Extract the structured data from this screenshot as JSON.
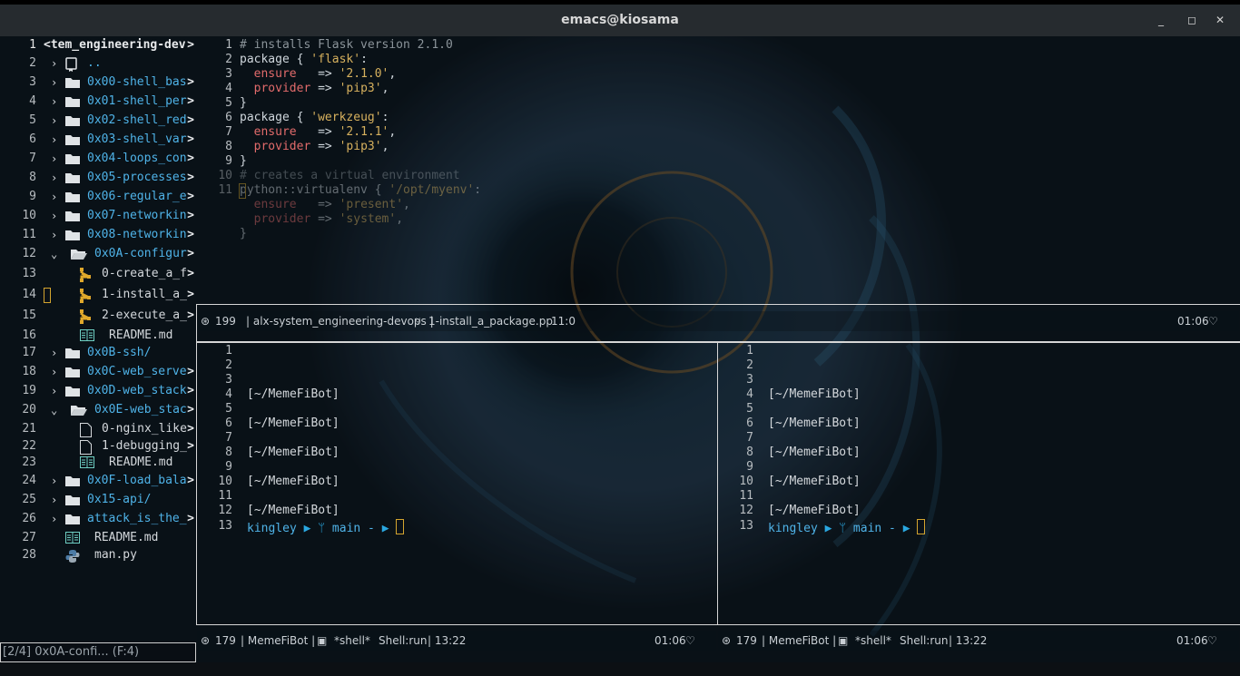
{
  "window": {
    "title": "emacs@kiosama",
    "minimize": "_",
    "maximize": "◻",
    "close": "✕"
  },
  "sidebar": {
    "rows": [
      {
        "ln": "1",
        "name": "<tem_engineering-dev",
        "kind": "root",
        "trunc": ">"
      },
      {
        "ln": "2",
        "name": "..",
        "kind": "up",
        "trunc": ""
      },
      {
        "ln": "3",
        "name": "0x00-shell_bas",
        "kind": "dir",
        "trunc": ">"
      },
      {
        "ln": "4",
        "name": "0x01-shell_per",
        "kind": "dir",
        "trunc": ">"
      },
      {
        "ln": "5",
        "name": "0x02-shell_red",
        "kind": "dir",
        "trunc": ">"
      },
      {
        "ln": "6",
        "name": "0x03-shell_var",
        "kind": "dir",
        "trunc": ">"
      },
      {
        "ln": "7",
        "name": "0x04-loops_con",
        "kind": "dir",
        "trunc": ">"
      },
      {
        "ln": "8",
        "name": "0x05-processes",
        "kind": "dir",
        "trunc": ">"
      },
      {
        "ln": "9",
        "name": "0x06-regular_e",
        "kind": "dir",
        "trunc": ">"
      },
      {
        "ln": "10",
        "name": "0x07-networkin",
        "kind": "dir",
        "trunc": ">"
      },
      {
        "ln": "11",
        "name": "0x08-networkin",
        "kind": "dir",
        "trunc": ">"
      },
      {
        "ln": "12",
        "name": "0x0A-configur",
        "kind": "diropen",
        "trunc": ">"
      },
      {
        "ln": "13",
        "name": "0-create_a_f",
        "kind": "pp",
        "trunc": ">"
      },
      {
        "ln": "14",
        "name": "1-install_a_",
        "kind": "pp",
        "trunc": ">"
      },
      {
        "ln": "15",
        "name": "2-execute_a_",
        "kind": "pp",
        "trunc": ">"
      },
      {
        "ln": "16",
        "name": "README.md",
        "kind": "md",
        "trunc": ""
      },
      {
        "ln": "17",
        "name": "0x0B-ssh/",
        "kind": "dir",
        "trunc": ""
      },
      {
        "ln": "18",
        "name": "0x0C-web_serve",
        "kind": "dir",
        "trunc": ">"
      },
      {
        "ln": "19",
        "name": "0x0D-web_stack",
        "kind": "dir",
        "trunc": ">"
      },
      {
        "ln": "20",
        "name": "0x0E-web_stac",
        "kind": "diropen",
        "trunc": ">"
      },
      {
        "ln": "21",
        "name": "0-nginx_like",
        "kind": "file",
        "trunc": ">"
      },
      {
        "ln": "22",
        "name": "1-debugging_",
        "kind": "file",
        "trunc": ">"
      },
      {
        "ln": "23",
        "name": "README.md",
        "kind": "md",
        "trunc": ""
      },
      {
        "ln": "24",
        "name": "0x0F-load_bala",
        "kind": "dir",
        "trunc": ">"
      },
      {
        "ln": "25",
        "name": "0x15-api/",
        "kind": "dir",
        "trunc": ""
      },
      {
        "ln": "26",
        "name": "attack_is_the_",
        "kind": "dir",
        "trunc": ">"
      },
      {
        "ln": "27",
        "name": "README.md",
        "kind": "md0",
        "trunc": ""
      },
      {
        "ln": "28",
        "name": "man.py",
        "kind": "py",
        "trunc": ""
      }
    ]
  },
  "editor": {
    "lines": [
      {
        "ln": "1",
        "text": "# installs Flask version 2.1.0"
      },
      {
        "ln": "2",
        "text": "package { 'flask':"
      },
      {
        "ln": "3",
        "text": "  ensure   => '2.1.0',"
      },
      {
        "ln": "4",
        "text": "  provider => 'pip3',"
      },
      {
        "ln": "5",
        "text": "}"
      },
      {
        "ln": "6",
        "text": "package { 'werkzeug':"
      },
      {
        "ln": "7",
        "text": "  ensure   => '2.1.1',"
      },
      {
        "ln": "8",
        "text": "  provider => 'pip3',"
      },
      {
        "ln": "9",
        "text": "}"
      },
      {
        "ln": "10",
        "text": "# creates a virtual environment"
      },
      {
        "ln": "11",
        "text": "python::virtualenv { '/opt/myenv':"
      },
      {
        "ln": "",
        "text": "  ensure   => 'present',"
      },
      {
        "ln": "",
        "text": "  provider => 'system',"
      },
      {
        "ln": "",
        "text": "}"
      }
    ],
    "modeline": {
      "icon": "⊛",
      "size": "199",
      "project": "| alx-system_engineering-devops |",
      "file": "1-install_a_package.pp",
      "pos": "11:0",
      "time": "01:06"
    }
  },
  "shells": [
    {
      "lines": [
        {
          "ln": "1",
          "text": ""
        },
        {
          "ln": "2",
          "text": ""
        },
        {
          "ln": "3",
          "text": ""
        },
        {
          "ln": "4",
          "text": "[~/MemeFiBot]"
        },
        {
          "ln": "5",
          "text": ""
        },
        {
          "ln": "6",
          "text": "[~/MemeFiBot]"
        },
        {
          "ln": "7",
          "text": ""
        },
        {
          "ln": "8",
          "text": "[~/MemeFiBot]"
        },
        {
          "ln": "9",
          "text": ""
        },
        {
          "ln": "10",
          "text": "[~/MemeFiBot]"
        },
        {
          "ln": "11",
          "text": ""
        },
        {
          "ln": "12",
          "text": "[~/MemeFiBot]"
        }
      ],
      "prompt": {
        "ln": "13",
        "user": "kingley",
        "branch": "main -"
      },
      "modeline": {
        "icon": "⊛",
        "size": "179",
        "buffer": "| MemeFiBot |",
        "shell": "*shell*",
        "mode": "Shell:run",
        "pos": "| 13:22",
        "time": "01:06"
      }
    },
    {
      "lines": [
        {
          "ln": "1",
          "text": ""
        },
        {
          "ln": "2",
          "text": ""
        },
        {
          "ln": "3",
          "text": ""
        },
        {
          "ln": "4",
          "text": "[~/MemeFiBot]"
        },
        {
          "ln": "5",
          "text": ""
        },
        {
          "ln": "6",
          "text": "[~/MemeFiBot]"
        },
        {
          "ln": "7",
          "text": ""
        },
        {
          "ln": "8",
          "text": "[~/MemeFiBot]"
        },
        {
          "ln": "9",
          "text": ""
        },
        {
          "ln": "10",
          "text": "[~/MemeFiBot]"
        },
        {
          "ln": "11",
          "text": ""
        },
        {
          "ln": "12",
          "text": "[~/MemeFiBot]"
        }
      ],
      "prompt": {
        "ln": "13",
        "user": "kingley",
        "branch": "main -"
      },
      "modeline": {
        "icon": "⊛",
        "size": "179",
        "buffer": "| MemeFiBot |",
        "shell": "*shell*",
        "mode": "Shell:run",
        "pos": "| 13:22",
        "time": "01:06"
      }
    }
  ],
  "minibuffer": {
    "text": "[2/4] 0x0A-confi... (F:4)"
  },
  "colors": {
    "accent": "#4fb3e8",
    "cursor": "#d4a52f",
    "frame": "#d6d6d6"
  }
}
